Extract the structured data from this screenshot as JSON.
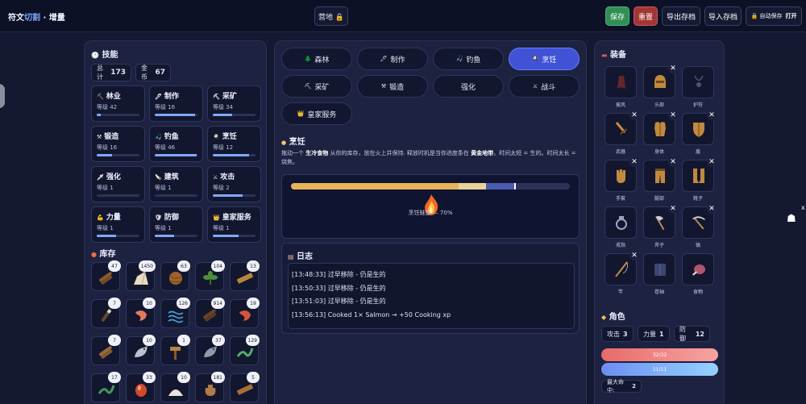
{
  "header": {
    "title_main": "符文",
    "title_accent": "切割",
    "title_sep": " · ",
    "title_sub": "增量",
    "camp": "营地 🔒",
    "save": "保存",
    "reset": "重置",
    "export": "导出存档",
    "import": "导入存档",
    "autosave": "🔒 自动保存",
    "autosave_state": "打开"
  },
  "skills": {
    "title": "技能",
    "total_label": "总计",
    "total": "173",
    "gold_label": "金币",
    "gold": "67",
    "items": [
      {
        "name": "林业",
        "icon": "⛏️",
        "level": "等级 42",
        "progress": 0.1
      },
      {
        "name": "制作",
        "icon": "🖊",
        "level": "等级 16",
        "progress": 0.95
      },
      {
        "name": "采矿",
        "icon": "⛏",
        "level": "等级 34",
        "progress": 0.45
      },
      {
        "name": "锻造",
        "icon": "⚒",
        "level": "等级 16",
        "progress": 0.35
      },
      {
        "name": "钓鱼",
        "icon": "🎣",
        "level": "等级 46",
        "progress": 0.98
      },
      {
        "name": "烹饪",
        "icon": "🍳",
        "level": "等级 12",
        "progress": 0.85
      },
      {
        "name": "强化",
        "icon": "🗡",
        "level": "等级 1",
        "progress": 0
      },
      {
        "name": "建筑",
        "icon": "🪚",
        "level": "等级 1",
        "progress": 0
      },
      {
        "name": "攻击",
        "icon": "⚔",
        "level": "等级 2",
        "progress": 0.7
      },
      {
        "name": "力量",
        "icon": "💪",
        "level": "等级 1",
        "progress": 0.45
      },
      {
        "name": "防御",
        "icon": "🛡",
        "level": "等级 1",
        "progress": 0.45
      },
      {
        "name": "皇家服务",
        "icon": "👑",
        "level": "等级 1",
        "progress": 0.6
      }
    ]
  },
  "inventory": {
    "title": "库存",
    "items": [
      {
        "qty": "47",
        "icon": "logs",
        "color": "#8a5a2b"
      },
      {
        "qty": "1450",
        "icon": "cloth",
        "color": "#e9dcc0"
      },
      {
        "qty": "63",
        "icon": "ball",
        "color": "#a0622d"
      },
      {
        "qty": "104",
        "icon": "herb",
        "color": "#4f8f3a"
      },
      {
        "qty": "13",
        "icon": "plank",
        "color": "#b8853e"
      },
      {
        "qty": "7",
        "icon": "stick",
        "color": "#6b4a26"
      },
      {
        "qty": "10",
        "icon": "shrimp",
        "color": "#e07a5f"
      },
      {
        "qty": "126",
        "icon": "water",
        "color": "#4aa3df"
      },
      {
        "qty": "914",
        "icon": "logs",
        "color": "#6b4426"
      },
      {
        "qty": "19",
        "icon": "shrimp",
        "color": "#d6553a"
      },
      {
        "qty": "7",
        "icon": "logs",
        "color": "#9a6a38"
      },
      {
        "qty": "10",
        "icon": "fish",
        "color": "#b9c3d0"
      },
      {
        "qty": "1",
        "icon": "hammer",
        "color": "#b8853e"
      },
      {
        "qty": "37",
        "icon": "fish",
        "color": "#8f9bab"
      },
      {
        "qty": "129",
        "icon": "eel",
        "color": "#4fae6a"
      },
      {
        "qty": "17",
        "icon": "eel",
        "color": "#3f9a55"
      },
      {
        "qty": "33",
        "icon": "egg",
        "color": "#d14a2a"
      },
      {
        "qty": "10",
        "icon": "pile",
        "color": "#e8e2d8"
      },
      {
        "qty": "181",
        "icon": "bag",
        "color": "#b07a4a"
      },
      {
        "qty": "5",
        "icon": "plank",
        "color": "#a66f38"
      }
    ]
  },
  "actions": {
    "items": [
      {
        "label": "森林",
        "icon": "🌲",
        "active": false
      },
      {
        "label": "制作",
        "icon": "🖊",
        "active": false
      },
      {
        "label": "钓鱼",
        "icon": "🎣",
        "active": false
      },
      {
        "label": "烹饪",
        "icon": "🍳",
        "active": true
      },
      {
        "label": "采矿",
        "icon": "⛏",
        "active": false
      },
      {
        "label": "锻造",
        "icon": "⚒",
        "active": false
      },
      {
        "label": "强化",
        "icon": "",
        "active": false
      },
      {
        "label": "战斗",
        "icon": "⚔",
        "active": false
      },
      {
        "label": "皇家服务",
        "icon": "👑",
        "active": false
      }
    ]
  },
  "cooking": {
    "title": "烹饪",
    "desc_pre": "拖动一个 ",
    "desc_b1": "生冷食物",
    "desc_mid": " 从你的库存，放在火上并保持. 释放时机是当你进度条在 ",
    "desc_b2": "黄金地带",
    "desc_post": "。时间太短 = 生的。时间太长 = 烧焦。",
    "caption": "烹饪鲑鱼 — 70%",
    "progress": 0.7,
    "zone_start": 0.6,
    "zone_end": 0.7
  },
  "log": {
    "title": "日志",
    "lines": [
      "[13:48:33] 过早移除 - 仍是生的",
      "[13:50:33] 过早移除 - 仍是生的",
      "[13:51:03] 过早移除 - 仍是生的",
      "[13:56:13] Cooked 1× Salmon → +50 Cooking xp"
    ]
  },
  "equipment": {
    "title": "装备",
    "slots": [
      {
        "label": "披风",
        "icon": "cape",
        "removable": false
      },
      {
        "label": "头部",
        "icon": "helm",
        "removable": true
      },
      {
        "label": "护符",
        "icon": "amulet",
        "removable": false
      },
      {
        "label": "武器",
        "icon": "sword",
        "removable": true
      },
      {
        "label": "身体",
        "icon": "body",
        "removable": true
      },
      {
        "label": "盾",
        "icon": "shield",
        "removable": true
      },
      {
        "label": "手套",
        "icon": "gloves",
        "removable": true
      },
      {
        "label": "腿部",
        "icon": "legs",
        "removable": true
      },
      {
        "label": "靴子",
        "icon": "boots",
        "removable": true
      },
      {
        "label": "戒指",
        "icon": "ring",
        "removable": false
      },
      {
        "label": "斧子",
        "icon": "axe",
        "removable": true
      },
      {
        "label": "镐",
        "icon": "pick",
        "removable": true
      },
      {
        "label": "竿",
        "icon": "rod",
        "removable": true
      },
      {
        "label": "卷轴",
        "icon": "book",
        "removable": false
      },
      {
        "label": "食物",
        "icon": "meat",
        "removable": false
      }
    ]
  },
  "character": {
    "title": "角色",
    "attack_label": "攻击",
    "attack": "3",
    "strength_label": "力量",
    "strength": "1",
    "defense_label": "防御",
    "defense": "12",
    "hp": "32/32",
    "mana": "11/11",
    "maxhit_label": "最大命中:",
    "maxhit": "2"
  }
}
